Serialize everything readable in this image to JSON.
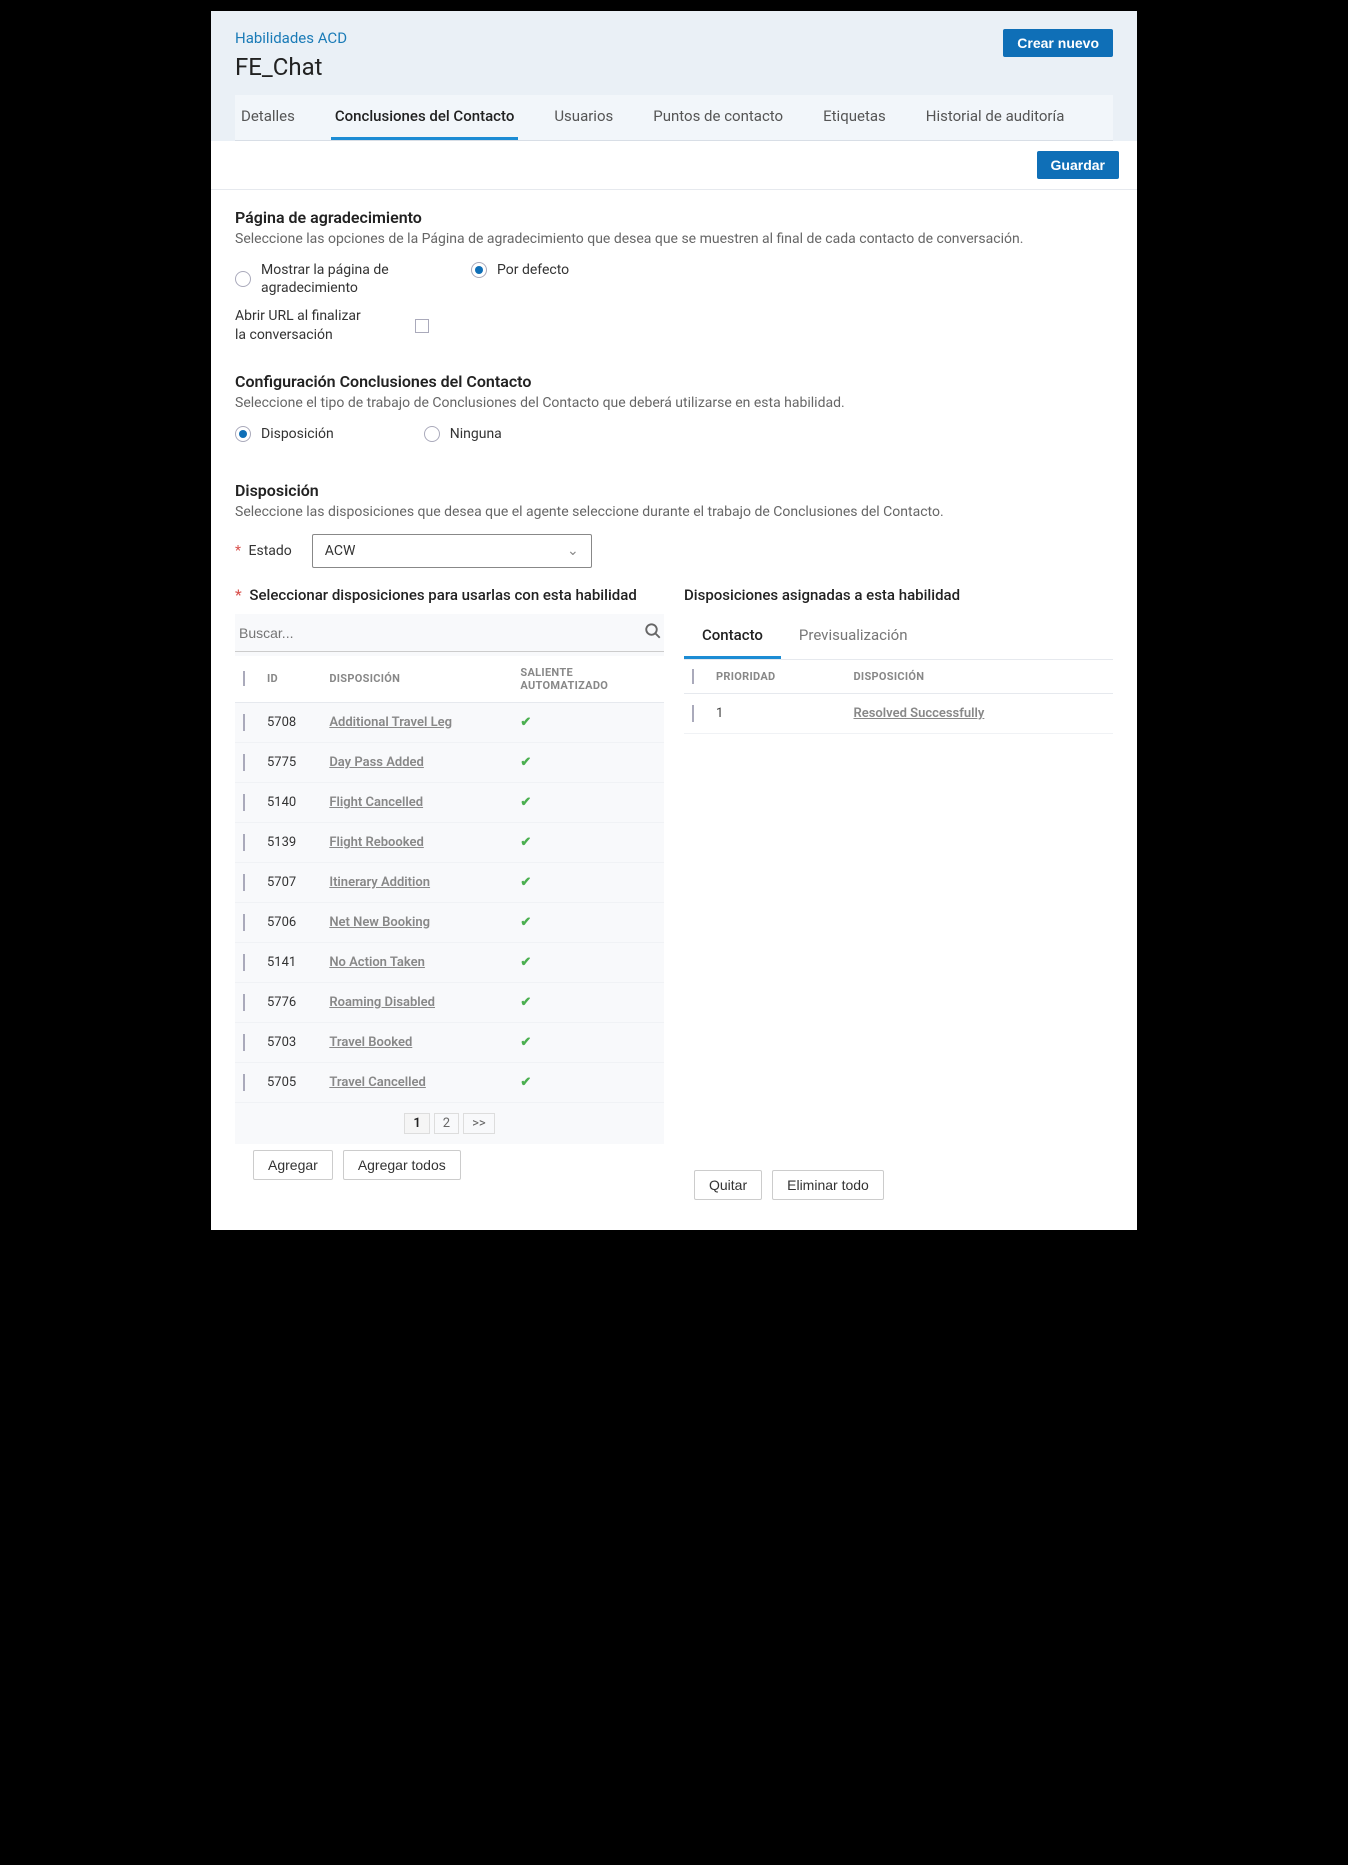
{
  "header": {
    "breadcrumb": "Habilidades ACD",
    "title": "FE_Chat",
    "create_new": "Crear nuevo"
  },
  "tabs": {
    "details": "Detalles",
    "post_contact": "Conclusiones del Contacto",
    "users": "Usuarios",
    "poc": "Puntos de contacto",
    "tags": "Etiquetas",
    "audit": "Historial de auditoría"
  },
  "actions": {
    "save": "Guardar",
    "add": "Agregar",
    "add_all": "Agregar todos",
    "remove": "Quitar",
    "remove_all": "Eliminar todo"
  },
  "thanks": {
    "title": "Página de agradecimiento",
    "desc": "Seleccione las opciones de la Página de agradecimiento que desea que se muestren al final de cada contacto de conversación.",
    "show_label": "Mostrar la página de agradecimiento",
    "default_label": "Por defecto",
    "open_url_label": "Abrir URL al finalizar la conversación"
  },
  "pcc": {
    "title": "Configuración Conclusiones del Contacto",
    "desc": "Seleccione el tipo de trabajo de Conclusiones del Contacto que deberá utilizarse en esta habilidad.",
    "disposition": "Disposición",
    "none": "Ninguna"
  },
  "dispo": {
    "title": "Disposición",
    "desc": "Seleccione las disposiciones que desea que el agente seleccione durante el trabajo de Conclusiones del Contacto.",
    "state_label": "Estado",
    "state_value": "ACW"
  },
  "left": {
    "title": "Seleccionar disposiciones para usarlas con esta habilidad",
    "search_placeholder": "Buscar...",
    "cols": {
      "id": "ID",
      "dispo": "DISPOSICIÓN",
      "outbound": "SALIENTE AUTOMATIZADO"
    },
    "rows": [
      {
        "id": "5708",
        "name": "Additional Travel Leg"
      },
      {
        "id": "5775",
        "name": "Day Pass Added"
      },
      {
        "id": "5140",
        "name": "Flight Cancelled"
      },
      {
        "id": "5139",
        "name": "Flight Rebooked"
      },
      {
        "id": "5707",
        "name": "Itinerary Addition"
      },
      {
        "id": "5706",
        "name": "Net New Booking"
      },
      {
        "id": "5141",
        "name": "No Action Taken"
      },
      {
        "id": "5776",
        "name": "Roaming Disabled"
      },
      {
        "id": "5703",
        "name": "Travel Booked"
      },
      {
        "id": "5705",
        "name": "Travel Cancelled"
      }
    ],
    "pager": {
      "p1": "1",
      "p2": "2",
      "next": ">>"
    }
  },
  "right": {
    "title": "Disposiciones asignadas a esta habilidad",
    "subtabs": {
      "contact": "Contacto",
      "preview": "Previsualización"
    },
    "cols": {
      "priority": "PRIORIDAD",
      "dispo": "DISPOSICIÓN"
    },
    "rows": [
      {
        "priority": "1",
        "name": "Resolved Successfully"
      }
    ]
  }
}
